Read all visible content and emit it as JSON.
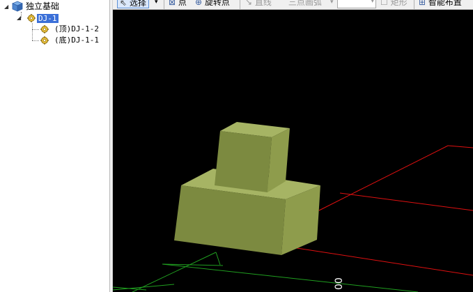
{
  "tree": {
    "root_label": "独立基础",
    "root_icon": "foundation-icon",
    "selected_item": {
      "label": "DJ-1",
      "icon": "gear-icon"
    },
    "children": [
      {
        "label": "(顶)DJ-1-2",
        "icon": "gear-icon"
      },
      {
        "label": "(底)DJ-1-1",
        "icon": "gear-icon"
      }
    ]
  },
  "toolbar": {
    "select_label": "选择",
    "point_label": "点",
    "rotate_point_label": "旋转点",
    "line_label": "直线",
    "three_point_arc_label": "三点画弧",
    "rectangle_label": "矩形",
    "smart_layout_label": "智能布置",
    "combo_value": ""
  },
  "viewport": {
    "background": "#000000",
    "block_color": "#8c9a4e",
    "axis_red": "#e01010",
    "axis_green": "#20b020",
    "label_text": "00"
  }
}
